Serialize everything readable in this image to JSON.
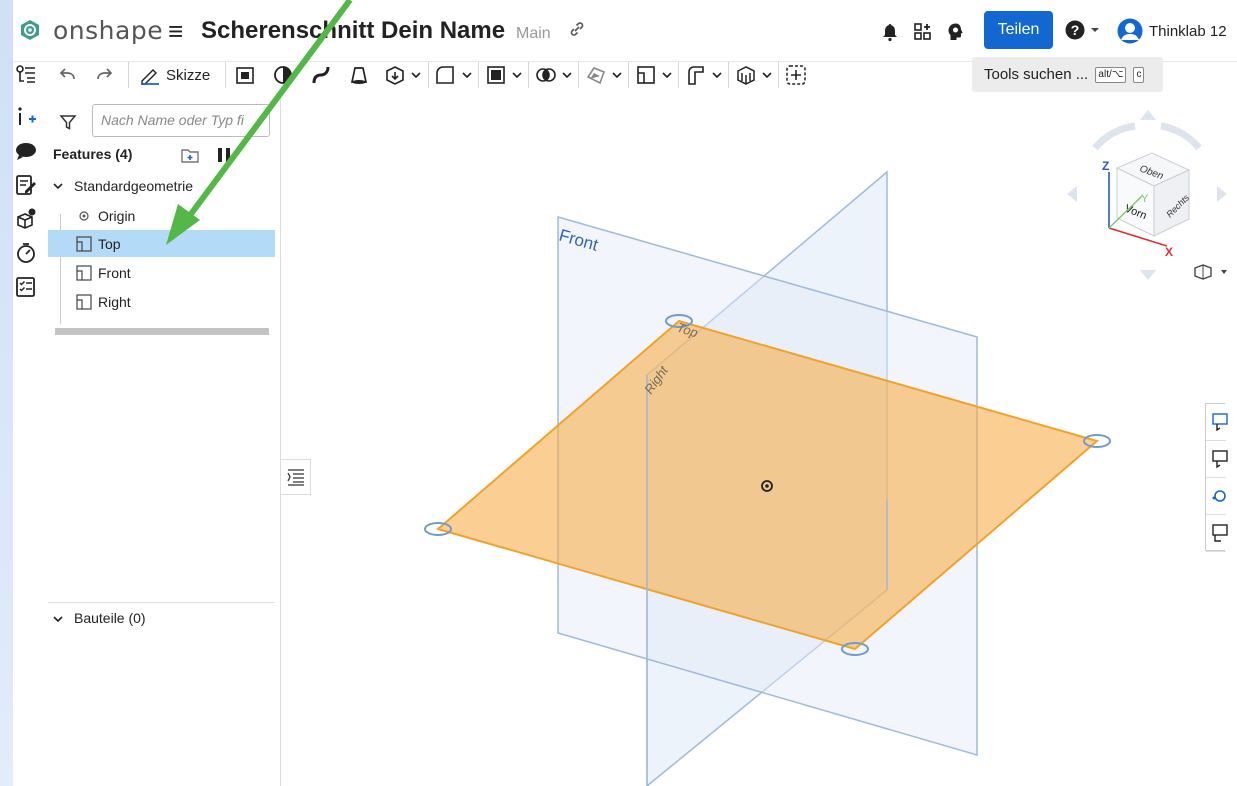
{
  "header": {
    "logo_text": "onshape",
    "doc_title": "Scherenschnitt Dein Name",
    "branch": "Main",
    "share_label": "Teilen",
    "user_name": "Thinklab 12"
  },
  "toolbar": {
    "sketch_label": "Skizze",
    "search_label": "Tools suchen ...",
    "search_kbd1": "alt/⌥",
    "search_kbd2": "c"
  },
  "panel": {
    "filter_placeholder": "Nach Name oder Typ fi",
    "features_label": "Features (4)",
    "tree": {
      "group": "Standardgeometrie",
      "origin": "Origin",
      "top": "Top",
      "front": "Front",
      "right": "Right"
    },
    "parts_label": "Bauteile (0)"
  },
  "viewport": {
    "plane_front": "Front",
    "plane_top": "Top",
    "plane_right": "Right",
    "cube_top": "Oben",
    "cube_front": "Vorn",
    "cube_right": "Rechts",
    "axis_x": "X",
    "axis_y": "Y",
    "axis_z": "Z"
  },
  "colors": {
    "accent": "#1367d1",
    "selection": "#b3daf7",
    "top_plane": "#f7a83a",
    "arrow": "#53b848",
    "logo": "#3a9e8a"
  }
}
